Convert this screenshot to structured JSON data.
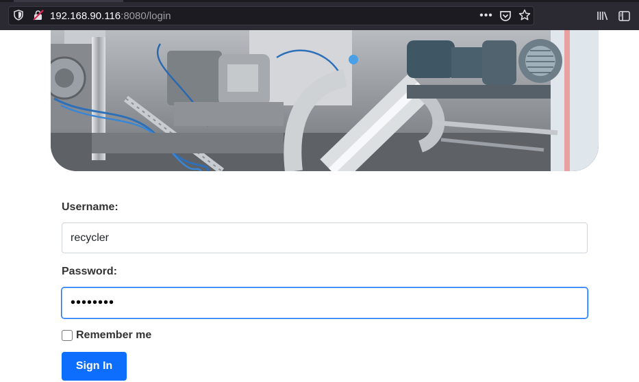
{
  "browser": {
    "url_host": "192.168.90.116",
    "url_rest": ":8080/login",
    "icons": [
      "shield-icon",
      "insecure-lock-icon",
      "more-actions-icon",
      "pocket-icon",
      "bookmark-star-icon",
      "library-icon",
      "sidebar-icon"
    ]
  },
  "hero": {
    "description_icon": "industrial-machinery-image"
  },
  "form": {
    "username_label": "Username:",
    "username_value": "recycler",
    "password_label": "Password:",
    "password_value": "••••••••",
    "remember_label": "Remember me",
    "remember_checked": false,
    "signin_label": "Sign In"
  },
  "colors": {
    "primary": "#0d6efd",
    "chrome_bg": "#2b2a33",
    "url_bg": "#1c1b22"
  }
}
